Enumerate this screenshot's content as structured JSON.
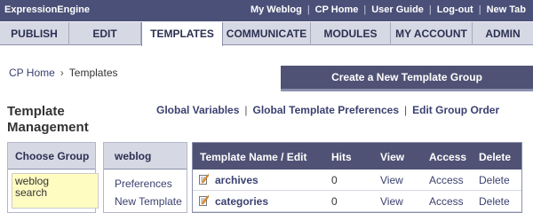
{
  "app": {
    "title": "ExpressionEngine"
  },
  "toplinks": [
    "My Weblog",
    "CP Home",
    "User Guide",
    "Log-out",
    "New Tab"
  ],
  "tabs": [
    "PUBLISH",
    "EDIT",
    "TEMPLATES",
    "COMMUNICATE",
    "MODULES",
    "MY ACCOUNT",
    "ADMIN"
  ],
  "active_tab": "TEMPLATES",
  "breadcrumb": {
    "home": "CP Home",
    "arrow": "›",
    "current": "Templates"
  },
  "create_button": "Create a New Template Group",
  "page_title": "Template Management",
  "actions": [
    "Global Variables",
    "Global Template Preferences",
    "Edit Group Order"
  ],
  "choose_group": {
    "header": "Choose Group",
    "groups": [
      "weblog",
      "search"
    ]
  },
  "weblog_panel": {
    "header": "weblog",
    "links": [
      "Preferences",
      "New Template"
    ]
  },
  "template_table": {
    "headers": [
      "Template Name / Edit",
      "Hits",
      "View",
      "Access",
      "Delete"
    ],
    "rows": [
      {
        "name": "archives",
        "hits": "0",
        "view": "View",
        "access": "Access",
        "delete": "Delete"
      },
      {
        "name": "categories",
        "hits": "0",
        "view": "View",
        "access": "Access",
        "delete": "Delete"
      }
    ]
  }
}
